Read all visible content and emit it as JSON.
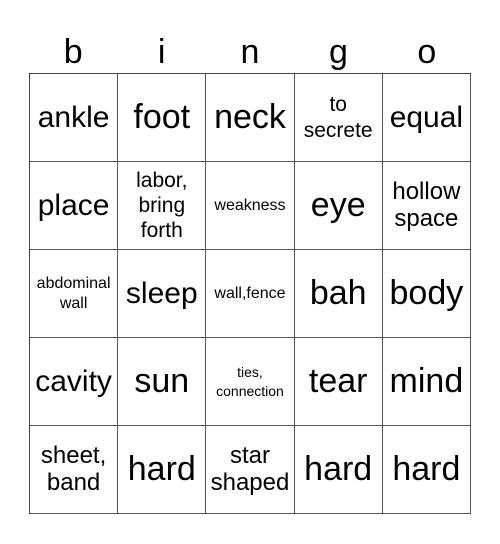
{
  "header": [
    "b",
    "i",
    "n",
    "g",
    "o"
  ],
  "cells": [
    [
      "ankle",
      "foot",
      "neck",
      "to secrete",
      "equal"
    ],
    [
      "place",
      "labor, bring forth",
      "weakness",
      "eye",
      "hollow space"
    ],
    [
      "abdominal wall",
      "sleep",
      "wall,fence",
      "bah",
      "body"
    ],
    [
      "cavity",
      "sun",
      "ties, connection",
      "tear",
      "mind"
    ],
    [
      "sheet, band",
      "hard",
      "star shaped",
      "hard",
      "hard"
    ]
  ]
}
